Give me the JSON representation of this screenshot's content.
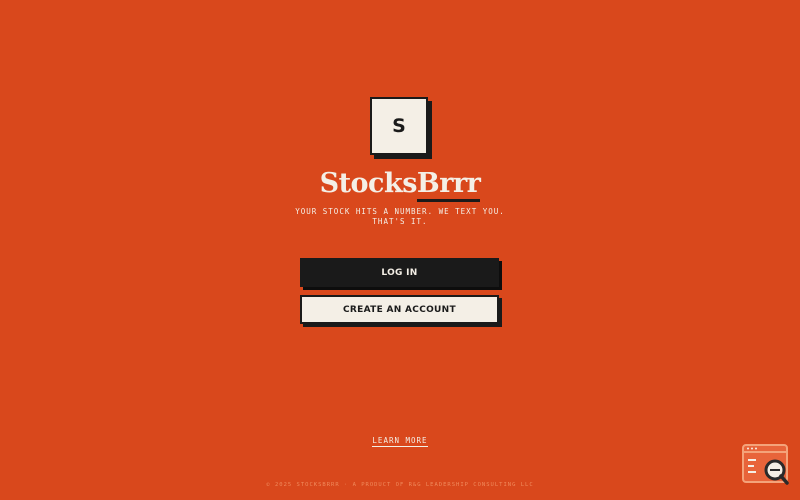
{
  "brand": {
    "logo_letter": "S",
    "name_part1": "Stocks",
    "name_part2": "Brrr",
    "tagline": "YOUR STOCK HITS A NUMBER. WE TEXT YOU. THAT'S IT."
  },
  "actions": {
    "login_label": "LOG IN",
    "create_label": "CREATE AN ACCOUNT"
  },
  "links": {
    "learn_more": "LEARN MORE"
  },
  "footer": {
    "text": "© 2025 STOCKSBRRR · A PRODUCT OF R&G LEADERSHIP CONSULTING LLC"
  },
  "theme": {
    "background": "#d9481c",
    "cream": "#f4efe6",
    "ink": "#1a1a1a"
  },
  "icons": {
    "widget": "browser-search-icon"
  }
}
